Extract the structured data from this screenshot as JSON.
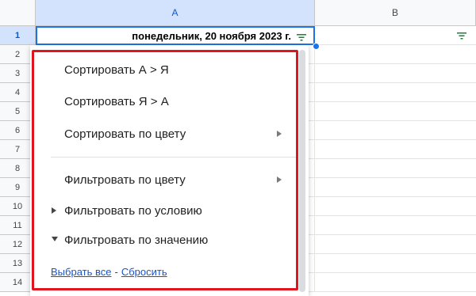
{
  "columns": [
    {
      "label": "A"
    },
    {
      "label": "B"
    }
  ],
  "rows": [
    "1",
    "2",
    "3",
    "4",
    "5",
    "6",
    "7",
    "8",
    "9",
    "10",
    "11",
    "12",
    "13",
    "14"
  ],
  "cell_a1": "понедельник, 20 ноября 2023 г.",
  "menu": {
    "sort_az": "Сортировать А > Я",
    "sort_za": "Сортировать Я > А",
    "sort_by_color": "Сортировать по цвету",
    "filter_by_color": "Фильтровать по цвету",
    "filter_by_condition": "Фильтровать по условию",
    "filter_by_value": "Фильтровать по значению",
    "select_all": "Выбрать все",
    "separator": "-",
    "reset": "Сбросить"
  },
  "colors": {
    "accent": "#1a73e8",
    "highlight_frame": "#e0161e",
    "link": "#1a54c4"
  },
  "icons": {
    "filter": "filter-icon",
    "submenu": "chevron-right-icon",
    "collapsed": "triangle-right-icon",
    "expanded": "triangle-down-icon"
  }
}
